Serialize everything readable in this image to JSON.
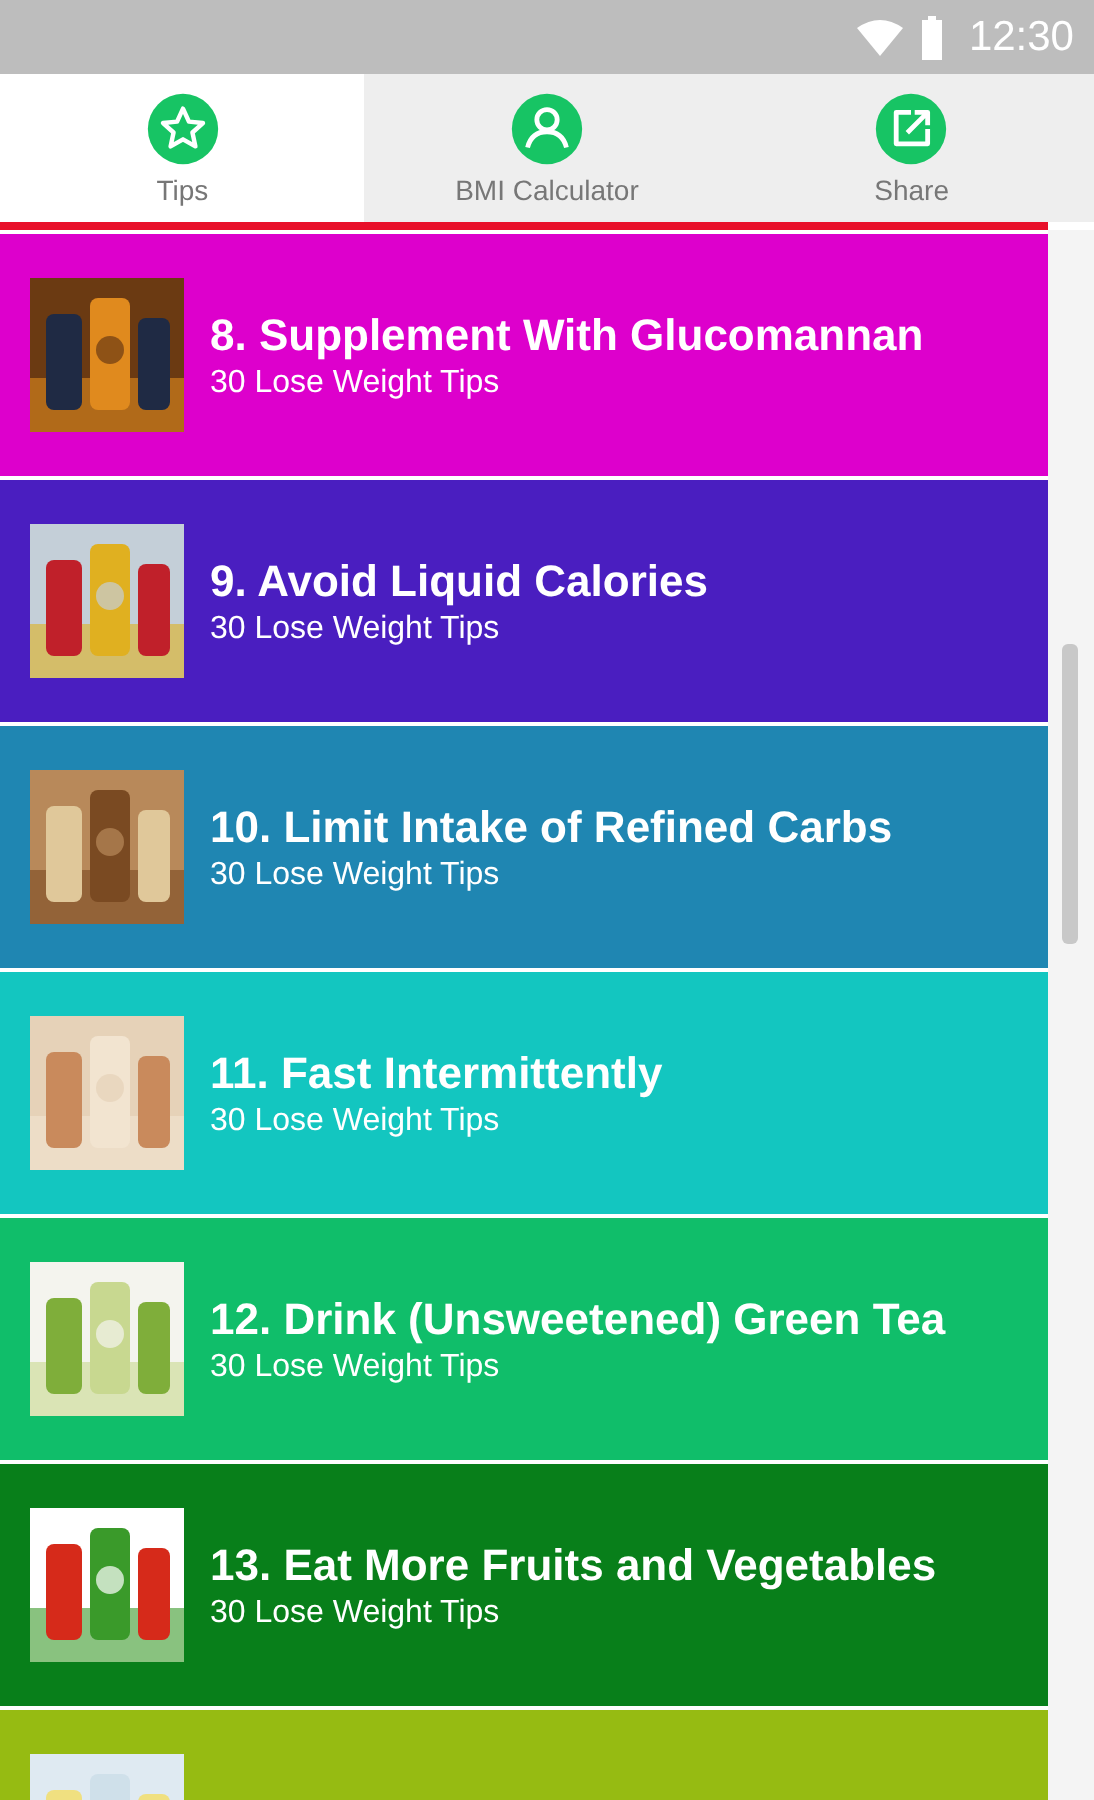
{
  "status_bar": {
    "time": "12:30"
  },
  "tabs": [
    {
      "label": "Tips",
      "kind": "star",
      "selected": true
    },
    {
      "label": "BMI Calculator",
      "kind": "person",
      "selected": false
    },
    {
      "label": "Share",
      "kind": "share",
      "selected": false
    }
  ],
  "tips": [
    {
      "title": "8. Supplement With Glucomannan",
      "subtitle": "30 Lose Weight Tips",
      "color": "#dd00cc"
    },
    {
      "title": "9. Avoid Liquid Calories",
      "subtitle": "30 Lose Weight Tips",
      "color": "#4a1ec0"
    },
    {
      "title": "10. Limit Intake of Refined Carbs",
      "subtitle": "30 Lose Weight Tips",
      "color": "#1f86b2"
    },
    {
      "title": "11. Fast Intermittently",
      "subtitle": "30 Lose Weight Tips",
      "color": "#13c6c0"
    },
    {
      "title": "12. Drink (Unsweetened) Green Tea",
      "subtitle": "30 Lose Weight Tips",
      "color": "#10be6a"
    },
    {
      "title": "13. Eat More Fruits and Vegetables",
      "subtitle": "30 Lose Weight Tips",
      "color": "#087f1a"
    },
    {
      "color": "#96bb12"
    }
  ]
}
